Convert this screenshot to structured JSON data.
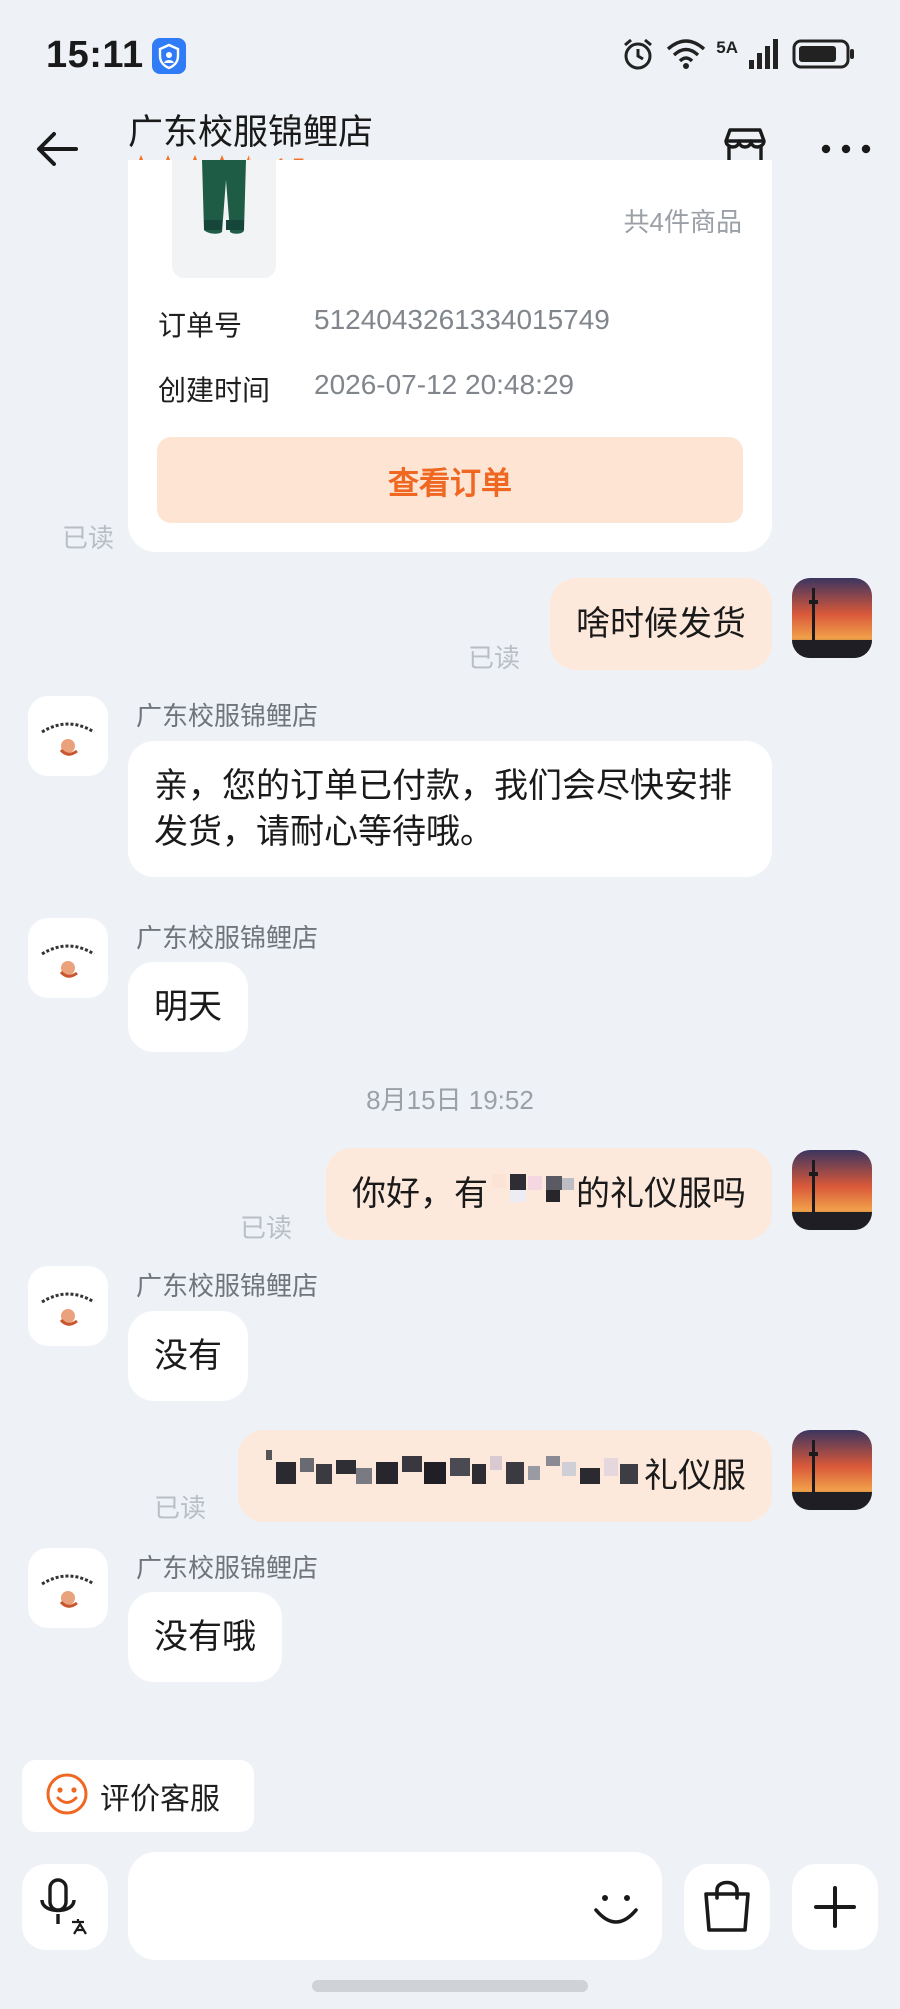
{
  "status_bar": {
    "time": "15:11",
    "network": "5A",
    "signal_bars": 4,
    "battery_level": 0.75,
    "icons": [
      "shield-icon",
      "alarm-icon",
      "wifi-icon",
      "signal-icon",
      "battery-icon"
    ]
  },
  "header": {
    "shop_name": "广东校服锦鲤店",
    "rating": "4.5",
    "rating_stars": 4.5,
    "back_icon": "back-arrow-icon",
    "store_icon": "store-icon",
    "more_icon": "more-icon"
  },
  "order_card": {
    "item_count": "共4件商品",
    "order_no_label": "订单号",
    "order_no": "5124043261334015749",
    "created_label": "创建时间",
    "created_time": "2026-07-12 20:48:29",
    "view_button": "查看订单",
    "read_status": "已读"
  },
  "messages": [
    {
      "direction": "out",
      "text": "啥时候发货",
      "read": "已读"
    },
    {
      "direction": "in",
      "sender": "广东校服锦鲤店",
      "text": "亲，您的订单已付款，我们会尽快安排发货，请耐心等待哦。"
    },
    {
      "direction": "in",
      "sender": "广东校服锦鲤店",
      "text": "明天"
    },
    {
      "direction": "out",
      "text_before": "你好，有",
      "text_after": "的礼仪服吗",
      "read": "已读"
    },
    {
      "direction": "in",
      "sender": "广东校服锦鲤店",
      "text": "没有"
    },
    {
      "direction": "out",
      "text_after": "礼仪服",
      "read": "已读"
    },
    {
      "direction": "in",
      "sender": "广东校服锦鲤店",
      "text": "没有哦"
    }
  ],
  "timestamp": "8月15日 19:52",
  "rate_chip": {
    "label": "评价客服",
    "icon": "smile-icon"
  },
  "input_bar": {
    "placeholder": "",
    "icons": [
      "voice-input-icon",
      "emoji-icon",
      "shopping-bag-icon",
      "plus-icon"
    ]
  },
  "colors": {
    "background": "#eef2f6",
    "accent": "#f06722",
    "outgoing_bubble": "#fde9dc",
    "button_bg": "#fde4d3",
    "star": "#f0742a"
  }
}
